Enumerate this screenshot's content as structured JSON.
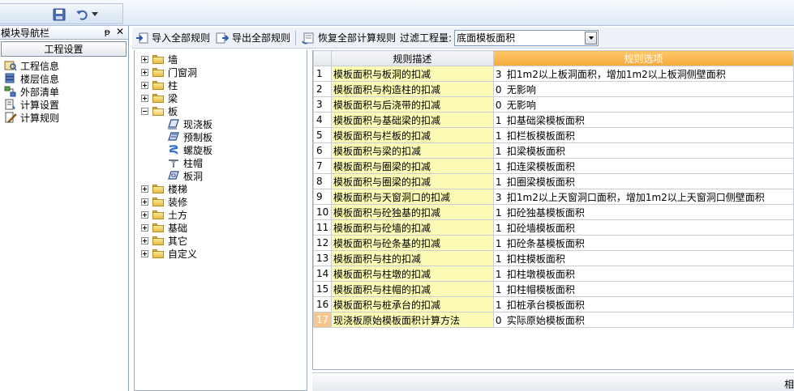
{
  "nav": {
    "title": "模块导航栏",
    "pin_glyph": "ᵽ",
    "close_glyph": "✕",
    "group": "工程设置",
    "items": [
      {
        "label": "工程信息",
        "icon": "project-info-icon"
      },
      {
        "label": "楼层信息",
        "icon": "floor-info-icon"
      },
      {
        "label": "外部清单",
        "icon": "external-list-icon"
      },
      {
        "label": "计算设置",
        "icon": "calc-settings-icon"
      },
      {
        "label": "计算规则",
        "icon": "calc-rules-icon"
      }
    ]
  },
  "toolbar": {
    "import_label": "导入全部规则",
    "export_label": "导出全部规则",
    "restore_label": "恢复全部计算规则",
    "filter_label": "过滤工程量:",
    "filter_value": "底面模板面积"
  },
  "tree": {
    "items": [
      {
        "label": "墙",
        "expanded": false
      },
      {
        "label": "门窗洞",
        "expanded": false
      },
      {
        "label": "柱",
        "expanded": false
      },
      {
        "label": "梁",
        "expanded": false
      },
      {
        "label": "板",
        "expanded": true,
        "children": [
          {
            "label": "现浇板",
            "icon": "cast-slab-icon"
          },
          {
            "label": "预制板",
            "icon": "precast-slab-icon"
          },
          {
            "label": "螺旋板",
            "icon": "spiral-slab-icon"
          },
          {
            "label": "柱帽",
            "icon": "column-cap-icon"
          },
          {
            "label": "板洞",
            "icon": "slab-hole-icon"
          }
        ]
      },
      {
        "label": "楼梯",
        "expanded": false
      },
      {
        "label": "装修",
        "expanded": false
      },
      {
        "label": "土方",
        "expanded": false
      },
      {
        "label": "基础",
        "expanded": false
      },
      {
        "label": "其它",
        "expanded": false
      },
      {
        "label": "自定义",
        "expanded": false
      }
    ]
  },
  "grid": {
    "headers": {
      "desc": "规则描述",
      "opt": "规则选项"
    },
    "rows": [
      {
        "num": "1",
        "desc": "模板面积与板洞的扣减",
        "code": "3",
        "opt": "扣1m2以上板洞面积，增加1m2以上板洞侧壁面积"
      },
      {
        "num": "2",
        "desc": "模板面积与构造柱的扣减",
        "code": "0",
        "opt": "无影响"
      },
      {
        "num": "3",
        "desc": "模板面积与后浇带的扣减",
        "code": "0",
        "opt": "无影响"
      },
      {
        "num": "4",
        "desc": "模板面积与基础梁的扣减",
        "code": "1",
        "opt": "扣基础梁模板面积"
      },
      {
        "num": "5",
        "desc": "模板面积与栏板的扣减",
        "code": "1",
        "opt": "扣栏板模板面积"
      },
      {
        "num": "6",
        "desc": "模板面积与梁的扣减",
        "code": "1",
        "opt": "扣梁模板面积"
      },
      {
        "num": "7",
        "desc": "模板面积与圈梁的扣减",
        "code": "1",
        "opt": "扣连梁模板面积"
      },
      {
        "num": "8",
        "desc": "模板面积与圈梁的扣减",
        "code": "1",
        "opt": "扣圈梁模板面积"
      },
      {
        "num": "9",
        "desc": "模板面积与天窗洞口的扣减",
        "code": "3",
        "opt": "扣1m2以上天窗洞口面积，增加1m2以上天窗洞口侧壁面积"
      },
      {
        "num": "10",
        "desc": "模板面积与砼独基的扣减",
        "code": "1",
        "opt": "扣砼独基模板面积"
      },
      {
        "num": "11",
        "desc": "模板面积与砼墙的扣减",
        "code": "1",
        "opt": "扣砼墙模板面积"
      },
      {
        "num": "12",
        "desc": "模板面积与砼条基的扣减",
        "code": "1",
        "opt": "扣砼条基模板面积"
      },
      {
        "num": "13",
        "desc": "模板面积与柱的扣减",
        "code": "1",
        "opt": "扣柱模板面积"
      },
      {
        "num": "14",
        "desc": "模板面积与柱墩的扣减",
        "code": "1",
        "opt": "扣柱墩模板面积"
      },
      {
        "num": "15",
        "desc": "模板面积与柱帽的扣减",
        "code": "1",
        "opt": "扣柱帽模板面积"
      },
      {
        "num": "16",
        "desc": "模板面积与桩承台的扣减",
        "code": "1",
        "opt": "扣桩承台模板面积"
      },
      {
        "num": "17",
        "desc": "现浇板原始模板面积计算方法",
        "code": "0",
        "opt": "实际原始模板面积",
        "active": true
      }
    ]
  },
  "bottom": {
    "label": "相"
  }
}
